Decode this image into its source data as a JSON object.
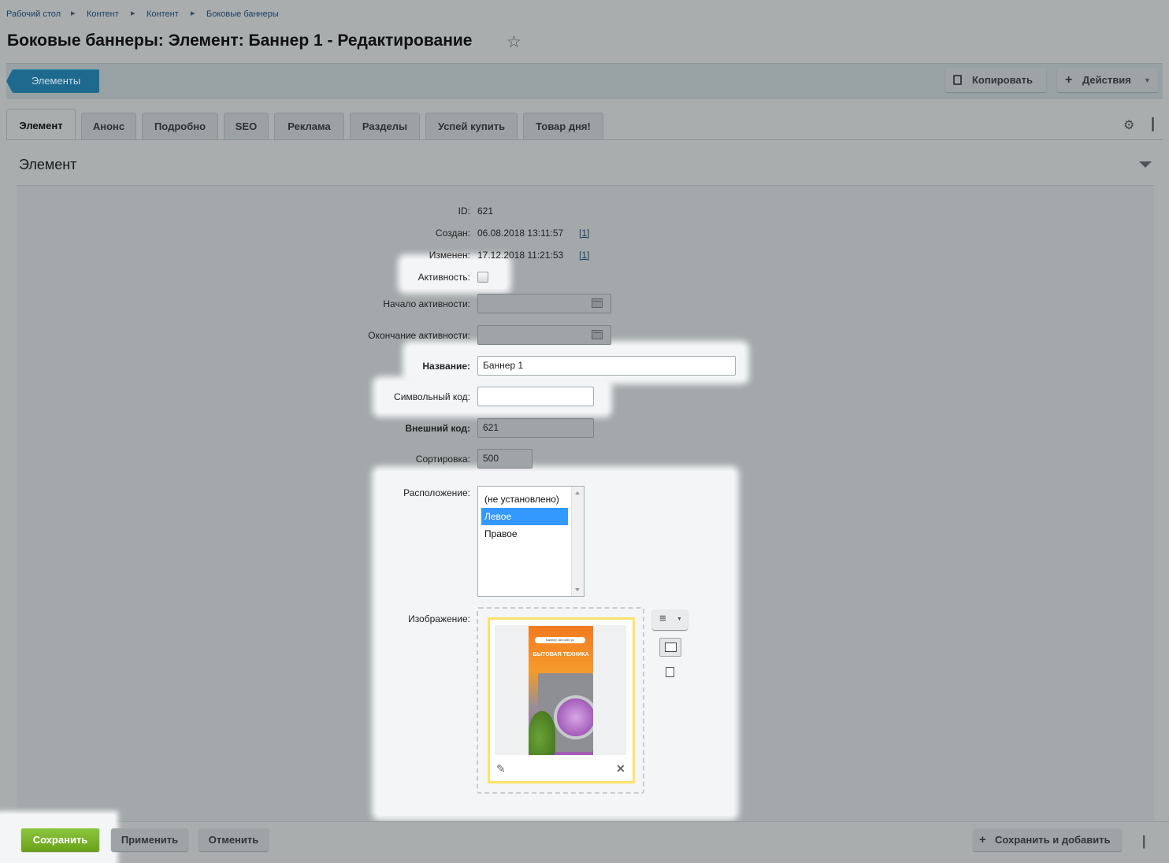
{
  "breadcrumb": [
    "Рабочий стол",
    "Контент",
    "Контент",
    "Боковые баннеры"
  ],
  "page_title": "Боковые баннеры: Элемент: Баннер 1 - Редактирование",
  "toolbar": {
    "elements_label": "Элементы",
    "copy_label": "Копировать",
    "actions_label": "Действия"
  },
  "tabs": [
    "Элемент",
    "Анонс",
    "Подробно",
    "SEO",
    "Реклама",
    "Разделы",
    "Успей купить",
    "Товар дня!"
  ],
  "section": {
    "title": "Элемент"
  },
  "fields": {
    "id_label": "ID:",
    "id_value": "621",
    "created_label": "Создан:",
    "created_value": "06.08.2018 13:11:57",
    "created_link": "[1]",
    "changed_label": "Изменен:",
    "changed_value": "17.12.2018 11:21:53",
    "changed_link": "[1]",
    "active_label": "Активность:",
    "active_checked": false,
    "active_from_label": "Начало активности:",
    "active_from_value": "",
    "active_to_label": "Окончание активности:",
    "active_to_value": "",
    "name_label": "Название:",
    "name_value": "Баннер 1",
    "code_label": "Символьный код:",
    "code_value": "",
    "xml_id_label": "Внешний код:",
    "xml_id_value": "621",
    "sort_label": "Сортировка:",
    "sort_value": "500",
    "position_label": "Расположение:",
    "position_options": [
      "(не установлено)",
      "Левое",
      "Правое"
    ],
    "position_selected": "Левое",
    "image_label": "Изображение:"
  },
  "banner_preview": {
    "tag": "Баннер 160×250 px",
    "headline": "БЫТОВАЯ ТЕХНИКА"
  },
  "footer": {
    "save_label": "Сохранить",
    "apply_label": "Применить",
    "cancel_label": "Отменить",
    "save_add_label": "Сохранить и добавить"
  },
  "colors": {
    "save_button": "#7ab62b",
    "elements_button": "#1e6a8f",
    "selected_option": "#3399ff",
    "image_frame": "#fde26a",
    "highlight": "#f3f5f6"
  }
}
